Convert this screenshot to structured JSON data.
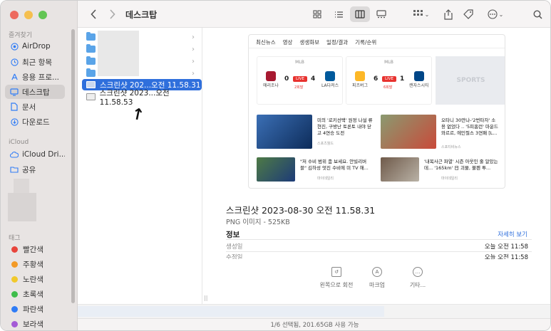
{
  "sidebar": {
    "favorites_header": "즐겨찾기",
    "favorites": [
      {
        "label": "AirDrop",
        "icon": "airdrop-icon"
      },
      {
        "label": "최근 항목",
        "icon": "clock-icon"
      },
      {
        "label": "응용 프로...",
        "icon": "applications-icon"
      },
      {
        "label": "데스크탑",
        "icon": "desktop-icon",
        "active": true
      },
      {
        "label": "문서",
        "icon": "document-icon"
      },
      {
        "label": "다운로드",
        "icon": "download-icon"
      }
    ],
    "icloud_header": "iCloud",
    "icloud": [
      {
        "label": "iCloud Dri...",
        "icon": "cloud-icon"
      },
      {
        "label": "공유",
        "icon": "shared-folder-icon"
      }
    ],
    "tags_header": "태그",
    "tags": [
      {
        "label": "빨간색",
        "color": "#e8453c"
      },
      {
        "label": "주황색",
        "color": "#f39a26"
      },
      {
        "label": "노란색",
        "color": "#f1c92c"
      },
      {
        "label": "초록색",
        "color": "#3fbd4b"
      },
      {
        "label": "파란색",
        "color": "#2f7cf6"
      },
      {
        "label": "보라색",
        "color": "#a45ad6"
      }
    ]
  },
  "toolbar": {
    "title": "데스크탑",
    "back_icon": "chevron-left-icon",
    "forward_icon": "chevron-right-icon"
  },
  "files": {
    "folders": [
      "",
      "",
      "",
      ""
    ],
    "items": [
      {
        "name": "스크린샷 202...오전 11.58.31",
        "selected": true
      },
      {
        "name": "스크린샷 2023...오전 11.58.53",
        "selected": false
      }
    ]
  },
  "thumbnail": {
    "nav": [
      "최신뉴스",
      "영상",
      "생생화보",
      "일정/결과",
      "기록/순위"
    ],
    "games": [
      {
        "league": "MLB",
        "home": "애리조나",
        "away": "LA다저스",
        "home_score": "0",
        "away_score": "4",
        "status": "LIVE",
        "inning": "2회말"
      },
      {
        "league": "MLB",
        "home": "피츠버그",
        "away": "캔자스시티",
        "home_score": "6",
        "away_score": "1",
        "status": "LIVE",
        "inning": "6회말"
      }
    ],
    "sports_label": "SPORTS",
    "news": [
      {
        "title": "미의 '로키선택' 원정 나설 류현진, 구방난 토론토 내야 닫고 4연승 도전",
        "source": "스포츠월드"
      },
      {
        "title": "오타니 30만나-'2번타자' 소용 없었다 .. '5피홈런' 마운드 와르르, 에인절스 3연패 [L...",
        "source": "스포티비뉴스"
      },
      {
        "title": "\"저 수비 범위 좀 보세요. 안빌리버블\" 김하성 엇진 수비에 미 TV 해...",
        "source": "마이데일리"
      },
      {
        "title": "'내복사근 파열' 시즌 아웃인 줄 알았는데... '165km' 日 괴물, 불펜 투...",
        "source": "마이데일리"
      }
    ]
  },
  "preview": {
    "title": "스크린샷 2023-08-30 오전 11.58.31",
    "subtitle": "PNG 이미지 - 525KB",
    "info_header": "정보",
    "more_link": "자세히 보기",
    "created_label": "생성일",
    "created_value": "오늘 오전 11:58",
    "modified_label": "수정일",
    "modified_value": "오늘 오전 11:58",
    "actions": [
      {
        "label": "왼쪽으로 회전",
        "icon": "rotate-left-icon"
      },
      {
        "label": "마크업",
        "icon": "markup-icon"
      },
      {
        "label": "기타...",
        "icon": "more-icon"
      }
    ]
  },
  "status": {
    "text": "1/6 선택됨, 201.65GB 사용 가능"
  }
}
